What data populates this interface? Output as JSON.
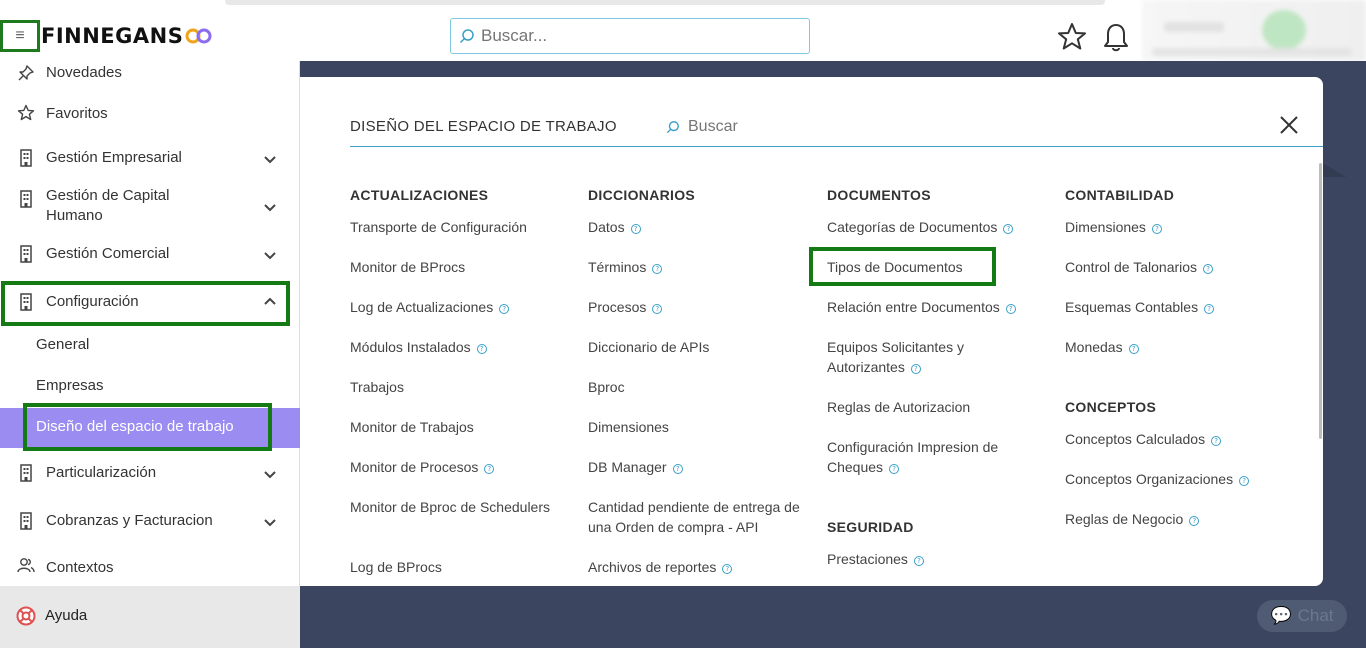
{
  "header": {
    "menu_icon": "hamburger-icon",
    "logo_text": "FINNEGANS",
    "search_placeholder": "Buscar...",
    "favorites_icon": "star-icon",
    "notifications_icon": "bell-icon"
  },
  "sidebar": {
    "items": [
      {
        "label": "Novedades",
        "icon": "pin-icon"
      },
      {
        "label": "Favoritos",
        "icon": "star-icon"
      },
      {
        "label": "Gestión Empresarial",
        "icon": "building-icon"
      },
      {
        "label": "Gestión de Capital Humano",
        "icon": "building-icon"
      },
      {
        "label": "Gestión Comercial",
        "icon": "building-icon"
      },
      {
        "label": "Configuración",
        "icon": "building-icon"
      },
      {
        "label": "Particularización",
        "icon": "building-icon"
      },
      {
        "label": "Cobranzas y Facturacion",
        "icon": "building-icon"
      },
      {
        "label": "Contextos",
        "icon": "users-icon"
      }
    ],
    "config_subitems": [
      "General",
      "Empresas",
      "Diseño del espacio de trabajo"
    ],
    "help_label": "Ayuda",
    "active_color": "#9b8cf2"
  },
  "panel": {
    "title": "DISEÑO DEL ESPACIO DE TRABAJO",
    "search_placeholder": "Buscar",
    "columns": [
      {
        "sections": [
          {
            "heading": "ACTUALIZACIONES",
            "links": [
              {
                "label": "Transporte de Configuración",
                "help": false
              },
              {
                "label": "Monitor de BProcs",
                "help": false
              },
              {
                "label": "Log de Actualizaciones",
                "help": true
              },
              {
                "label": "Módulos Instalados",
                "help": true
              },
              {
                "label": "Trabajos",
                "help": false
              },
              {
                "label": "Monitor de Trabajos",
                "help": false
              },
              {
                "label": "Monitor de Procesos",
                "help": true
              },
              {
                "label": "Monitor de Bproc de Schedulers",
                "help": false
              },
              {
                "label": "Log de BProcs",
                "help": false
              }
            ]
          }
        ]
      },
      {
        "sections": [
          {
            "heading": "DICCIONARIOS",
            "links": [
              {
                "label": "Datos",
                "help": true
              },
              {
                "label": "Términos",
                "help": true
              },
              {
                "label": "Procesos",
                "help": true
              },
              {
                "label": "Diccionario de APIs",
                "help": false
              },
              {
                "label": "Bproc",
                "help": false
              },
              {
                "label": "Dimensiones",
                "help": false
              },
              {
                "label": "DB Manager",
                "help": true
              },
              {
                "label": "Cantidad pendiente de entrega de una Orden de compra - API",
                "help": false
              },
              {
                "label": "Archivos de reportes",
                "help": true
              }
            ]
          }
        ]
      },
      {
        "sections": [
          {
            "heading": "DOCUMENTOS",
            "links": [
              {
                "label": "Categorías de Documentos",
                "help": true
              },
              {
                "label": "Tipos de Documentos",
                "help": false
              },
              {
                "label": "Relación entre Documentos",
                "help": true
              },
              {
                "label": "Equipos Solicitantes y Autorizantes",
                "help": true
              },
              {
                "label": "Reglas de Autorizacion",
                "help": false
              },
              {
                "label": "Configuración Impresion de Cheques",
                "help": true
              }
            ]
          },
          {
            "heading": "SEGURIDAD",
            "links": [
              {
                "label": "Prestaciones",
                "help": true
              }
            ]
          }
        ]
      },
      {
        "sections": [
          {
            "heading": "CONTABILIDAD",
            "links": [
              {
                "label": "Dimensiones",
                "help": true
              },
              {
                "label": "Control de Talonarios",
                "help": true
              },
              {
                "label": "Esquemas Contables",
                "help": true
              },
              {
                "label": "Monedas",
                "help": true
              }
            ]
          },
          {
            "heading": "CONCEPTOS",
            "links": [
              {
                "label": "Conceptos Calculados",
                "help": true
              },
              {
                "label": "Conceptos Organizaciones",
                "help": true
              },
              {
                "label": "Reglas de Negocio",
                "help": true
              }
            ]
          }
        ]
      }
    ]
  },
  "chat": {
    "label": "Chat"
  },
  "colors": {
    "highlight": "#147a14",
    "accent": "#3aa0c8",
    "background_dark": "#3b4560"
  }
}
